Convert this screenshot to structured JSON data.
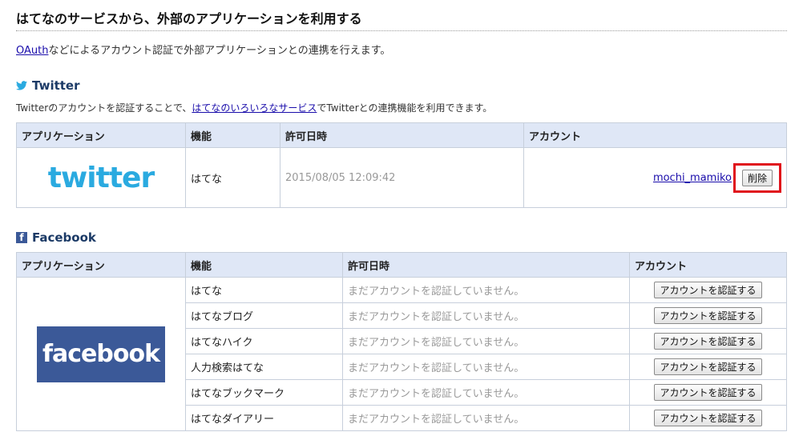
{
  "page": {
    "title": "はてなのサービスから、外部のアプリケーションを利用する",
    "intro_link": "OAuth",
    "intro_text": "などによるアカウント認証で外部アプリケーションとの連携を行えます。"
  },
  "twitter": {
    "heading": "Twitter",
    "desc_prefix": "Twitterのアカウントを認証することで、",
    "desc_link": "はてなのいろいろなサービス",
    "desc_suffix": "でTwitterとの連携機能を利用できます。",
    "headers": [
      "アプリケーション",
      "機能",
      "許可日時",
      "アカウント"
    ],
    "logo_text": "twitter",
    "row": {
      "feature": "はてな",
      "datetime": "2015/08/05 12:09:42",
      "account": "mochi_mamiko",
      "delete_label": "削除"
    }
  },
  "facebook": {
    "heading": "Facebook",
    "headers": [
      "アプリケーション",
      "機能",
      "許可日時",
      "アカウント"
    ],
    "logo_text": "facebook",
    "rows": [
      {
        "feature": "はてな",
        "status": "まだアカウントを認証していません。",
        "button": "アカウントを認証する"
      },
      {
        "feature": "はてなブログ",
        "status": "まだアカウントを認証していません。",
        "button": "アカウントを認証する"
      },
      {
        "feature": "はてなハイク",
        "status": "まだアカウントを認証していません。",
        "button": "アカウントを認証する"
      },
      {
        "feature": "人力検索はてな",
        "status": "まだアカウントを認証していません。",
        "button": "アカウントを認証する"
      },
      {
        "feature": "はてなブックマーク",
        "status": "まだアカウントを認証していません。",
        "button": "アカウントを認証する"
      },
      {
        "feature": "はてなダイアリー",
        "status": "まだアカウントを認証していません。",
        "button": "アカウントを認証する"
      }
    ]
  },
  "colors": {
    "header_bg": "#dfe7f6",
    "twitter_blue": "#2aaae0",
    "facebook_blue": "#3b5998",
    "highlight_red": "#e0111b"
  }
}
